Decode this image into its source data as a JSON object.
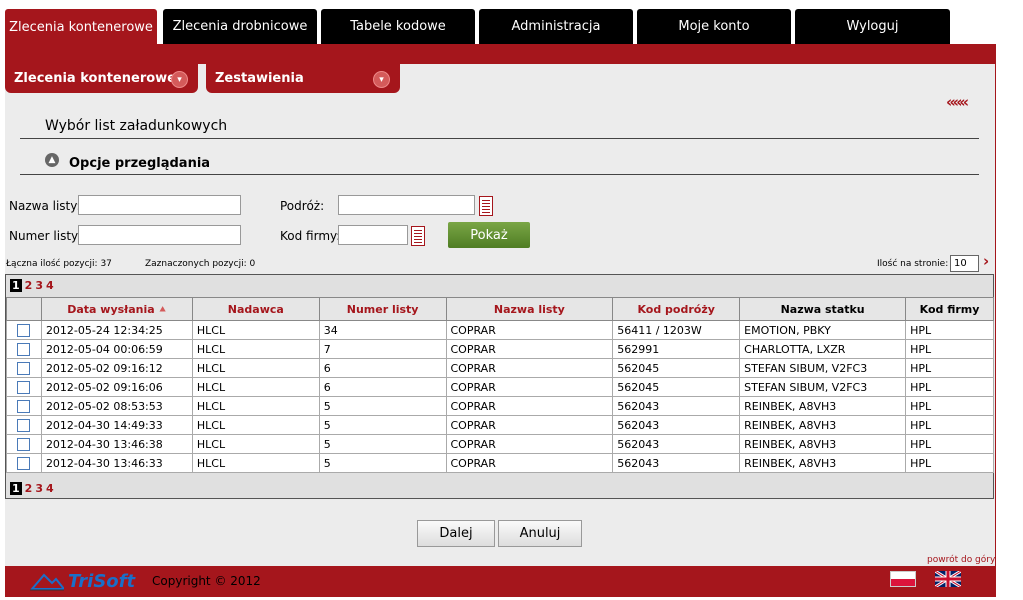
{
  "top_nav": [
    {
      "label": "Zlecenia kontenerowe",
      "active": true
    },
    {
      "label": "Zlecenia drobnicowe",
      "active": false
    },
    {
      "label": "Tabele kodowe",
      "active": false
    },
    {
      "label": "Administracja",
      "active": false
    },
    {
      "label": "Moje konto",
      "active": false
    },
    {
      "label": "Wyloguj",
      "active": false
    }
  ],
  "sub_tabs": [
    {
      "label": "Zlecenia kontenerowe",
      "icon": "chevron-icon"
    },
    {
      "label": "Zestawienia",
      "icon": "chevron-icon"
    }
  ],
  "back_label": "«««",
  "page_title": "Wybór list załadunkowych",
  "options_title": "Opcje przeglądania",
  "filters": {
    "nazwa_listy_label": "Nazwa listy:",
    "nazwa_listy_value": "",
    "numer_listy_label": "Numer listy:",
    "numer_listy_value": "",
    "podroz_label": "Podróż:",
    "podroz_value": "",
    "kod_firmy_label": "Kod firmy:",
    "kod_firmy_value": "",
    "show_button": "Pokaż"
  },
  "summary": {
    "total_label": "Łączna ilość pozycji: 37",
    "selected_label": "Zaznaczonych pozycji: 0",
    "per_page_label": "Ilość na stronie:",
    "per_page_value": "10",
    "next_label": "›"
  },
  "pager": {
    "current": "1",
    "pages": [
      "2",
      "3",
      "4"
    ]
  },
  "columns": [
    {
      "label": "Data wysłania",
      "sortable": true,
      "sorted": true
    },
    {
      "label": "Nadawca",
      "sortable": true
    },
    {
      "label": "Numer listy",
      "sortable": true
    },
    {
      "label": "Nazwa listy",
      "sortable": true
    },
    {
      "label": "Kod podróży",
      "sortable": true
    },
    {
      "label": "Nazwa statku",
      "sortable": false
    },
    {
      "label": "Kod firmy",
      "sortable": false
    }
  ],
  "sort_indicator": "⯅",
  "rows": [
    [
      "2012-05-24 12:34:25",
      "HLCL",
      "34",
      "COPRAR",
      "56411 / 1203W",
      "EMOTION, PBKY",
      "HPL"
    ],
    [
      "2012-05-04 00:06:59",
      "HLCL",
      "7",
      "COPRAR",
      "562991",
      "CHARLOTTA, LXZR",
      "HPL"
    ],
    [
      "2012-05-02 09:16:12",
      "HLCL",
      "6",
      "COPRAR",
      "562045",
      "STEFAN SIBUM, V2FC3",
      "HPL"
    ],
    [
      "2012-05-02 09:16:06",
      "HLCL",
      "6",
      "COPRAR",
      "562045",
      "STEFAN SIBUM, V2FC3",
      "HPL"
    ],
    [
      "2012-05-02 08:53:53",
      "HLCL",
      "5",
      "COPRAR",
      "562043",
      "REINBEK, A8VH3",
      "HPL"
    ],
    [
      "2012-04-30 14:49:33",
      "HLCL",
      "5",
      "COPRAR",
      "562043",
      "REINBEK, A8VH3",
      "HPL"
    ],
    [
      "2012-04-30 13:46:38",
      "HLCL",
      "5",
      "COPRAR",
      "562043",
      "REINBEK, A8VH3",
      "HPL"
    ],
    [
      "2012-04-30 13:46:33",
      "HLCL",
      "5",
      "COPRAR",
      "562043",
      "REINBEK, A8VH3",
      "HPL"
    ]
  ],
  "buttons": {
    "next": "Dalej",
    "cancel": "Anuluj"
  },
  "back_to_top": "powrót do góry",
  "footer": {
    "logo_text": "TriSoft",
    "copyright": "Copyright © 2012",
    "flags": [
      "pl-flag-icon",
      "uk-flag-icon"
    ]
  },
  "colors": {
    "brand": "#a5161c",
    "green_button": "#5e8d2e",
    "logo": "#1a6fc9"
  }
}
